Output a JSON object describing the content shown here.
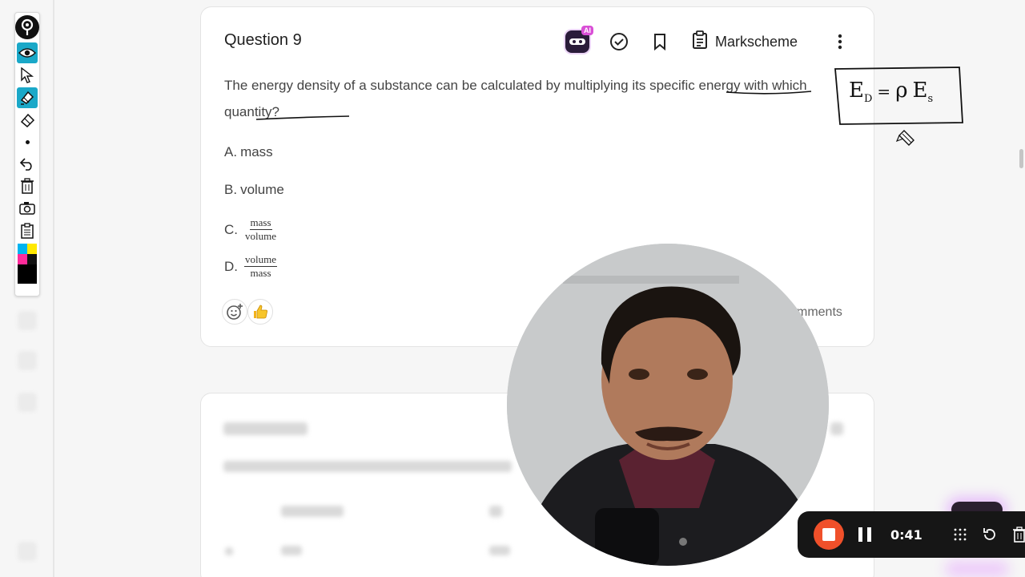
{
  "question": {
    "title": "Question 9",
    "markscheme_label": "Markscheme",
    "ai_badge": "AI",
    "text": "The energy density of a substance can be calculated by multiplying its specific energy with which quantity?",
    "options": [
      {
        "letter": "A.",
        "text": "mass"
      },
      {
        "letter": "B.",
        "text": "volume"
      },
      {
        "letter": "C.",
        "numerator": "mass",
        "denominator": "volume"
      },
      {
        "letter": "D.",
        "numerator": "volume",
        "denominator": "mass"
      }
    ],
    "comments_partial": "mments"
  },
  "annotation": {
    "formula_lhs": "E",
    "formula_lhs_sub": "D",
    "formula_eq": "=",
    "formula_rho": "ρ",
    "formula_rhs": "E",
    "formula_rhs_sub": "s"
  },
  "recorder": {
    "time": "0:41"
  },
  "colors": {
    "accent_teal": "#1aa8c8",
    "record_red": "#f0502a",
    "ai_pink": "#d94fd6"
  },
  "icons": [
    "eye-icon",
    "cursor-icon",
    "highlighter-icon",
    "eraser-icon",
    "undo-icon",
    "trash-icon",
    "camera-icon",
    "clipboard-icon",
    "check-circle-icon",
    "bookmark-icon",
    "clipboard-icon",
    "more-vertical-icon",
    "smiley-add-icon",
    "thumbs-up-icon",
    "grid-icon",
    "restart-icon",
    "trash-icon"
  ]
}
